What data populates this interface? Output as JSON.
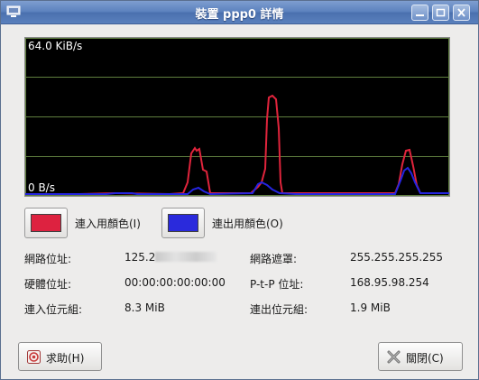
{
  "window": {
    "title": "裝置 ppp0 詳情"
  },
  "graph": {
    "top_label": "64.0 KiB/s",
    "bottom_label": "0 B/s",
    "colors": {
      "incoming": "#e0243c",
      "outgoing": "#2424e0",
      "grid": "#5f7f3f"
    }
  },
  "legend": {
    "incoming": {
      "label": "連入用顏色(I)",
      "color": "#dd2240"
    },
    "outgoing": {
      "label": "連出用顏色(O)",
      "color": "#2a2adc"
    }
  },
  "info": {
    "ip_label": "網路位址:",
    "ip_value": "125.2",
    "netmask_label": "網路遮罩:",
    "netmask_value": "255.255.255.255",
    "hw_label": "硬體位址:",
    "hw_value": "00:00:00:00:00:00",
    "ptp_label": "P-t-P 位址:",
    "ptp_value": "168.95.98.254",
    "rx_label": "連入位元組:",
    "rx_value": "8.3 MiB",
    "tx_label": "連出位元組:",
    "tx_value": "1.9 MiB"
  },
  "buttons": {
    "help": "求助(H)",
    "close": "關閉(C)"
  }
}
